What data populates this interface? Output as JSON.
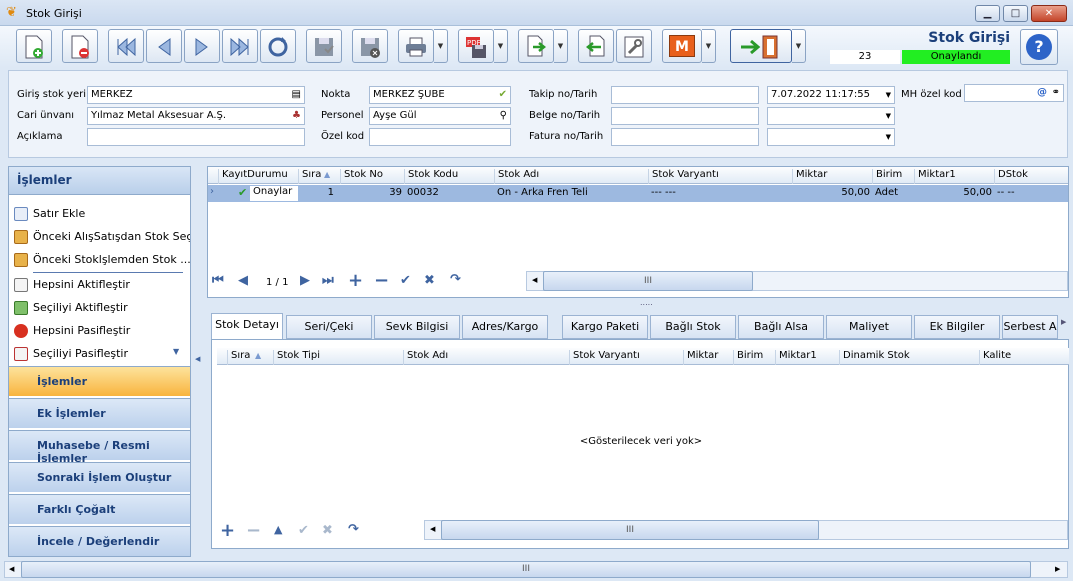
{
  "window": {
    "title": "Stok Girişi",
    "min": "▁",
    "max": "□",
    "close": "✕"
  },
  "status": {
    "title": "Stok Girişi",
    "number": "23",
    "state": "Onaylandı",
    "state_color": "#22ee22",
    "help": "?"
  },
  "toolbar": {
    "m_label": "M"
  },
  "form": {
    "giris_stok_yeri_label": "Giriş stok yeri",
    "giris_stok_yeri": "MERKEZ",
    "cari_unvani_label": "Cari ünvanı",
    "cari_unvani": "Yılmaz Metal Aksesuar A.Ş.",
    "aciklama_label": "Açıklama",
    "aciklama": "",
    "nokta_label": "Nokta",
    "nokta": "MERKEZ ŞUBE",
    "personel_label": "Personel",
    "personel": "Ayşe Gül",
    "ozel_kod_label": "Özel kod",
    "ozel_kod": "",
    "takip_label": "Takip no/Tarih",
    "takip": "",
    "takip_tarih": "7.07.2022 11:17:55",
    "belge_label": "Belge no/Tarih",
    "belge": "",
    "belge_tarih": "",
    "fatura_label": "Fatura no/Tarih",
    "fatura": "",
    "fatura_tarih": "",
    "mh_label": "MH özel kod",
    "mh": "",
    "at_sign": "@"
  },
  "left": {
    "header": "İşlemler",
    "items": [
      {
        "label": "Satır Ekle"
      },
      {
        "label": "Önceki AlışSatışdan Stok Seç"
      },
      {
        "label": "Önceki Stoklşlemden Stok ..."
      },
      {
        "label": "Hepsini Aktifleştir"
      },
      {
        "label": "Seçiliyi Aktifleştir"
      },
      {
        "label": "Hepsini Pasifleştir"
      },
      {
        "label": "Seçiliyi Pasifleştir"
      }
    ],
    "nav": [
      "İşlemler",
      "Ek İşlemler",
      "Muhasebe / Resmi İşlemler",
      "Sonraki İşlem Oluştur",
      "Farklı Çoğalt",
      "İncele / Değerlendir"
    ]
  },
  "grid": {
    "columns": [
      "KayıtDurumu",
      "Sıra",
      "Stok No",
      "Stok Kodu",
      "Stok Adı",
      "Stok Varyantı",
      "Miktar",
      "Birim",
      "Miktar1",
      "DStok"
    ],
    "row": {
      "kayit": "Onaylar",
      "sira": "1",
      "stok_no": "39",
      "stok_kodu": "00032",
      "stok_adi": "Ön - Arka Fren Teli",
      "varyant": "--- ---",
      "miktar": "50,00",
      "birim": "Adet",
      "miktar1": "50,00",
      "dstok": "-- --"
    },
    "pager": "1 / 1",
    "scroll_thumb": "III",
    "splitter": "....."
  },
  "tabs": [
    "Stok Detayı",
    "Seri/Çeki",
    "Sevk Bilgisi",
    "Adres/Kargo",
    "Kargo Paketi",
    "Bağlı Stok",
    "Bağlı Alsa",
    "Maliyet",
    "Ek Bilgiler",
    "Serbest A"
  ],
  "detail": {
    "columns": [
      "Sıra",
      "Stok Tipi",
      "Stok Adı",
      "Stok Varyantı",
      "Miktar",
      "Birim",
      "Miktar1",
      "Dinamik Stok",
      "Kalite"
    ],
    "empty": "<Gösterilecek veri yok>",
    "scroll_thumb": "III"
  },
  "bottom": {
    "scroll_thumb": "III"
  }
}
